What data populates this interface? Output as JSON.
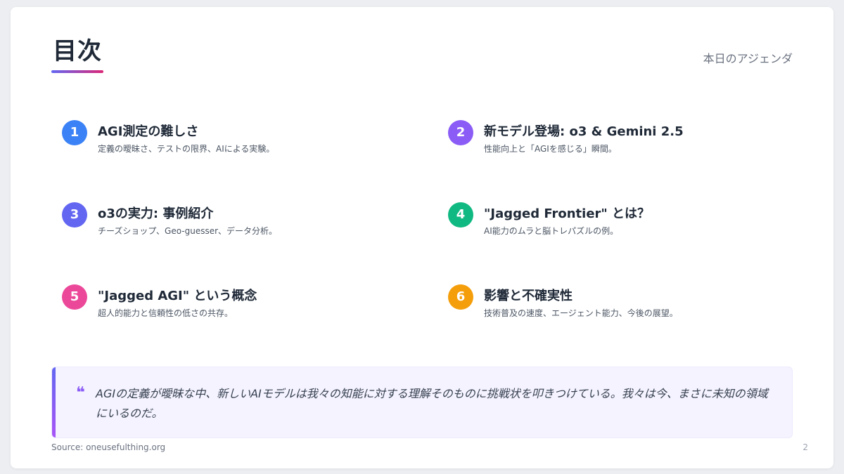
{
  "header": {
    "title": "目次",
    "subtitle": "本日のアジェンダ"
  },
  "items": [
    {
      "number": "1",
      "title": "AGI測定の難しさ",
      "description": "定義の曖昧さ、テストの限界、AIによる実験。",
      "color": "#3b82f6"
    },
    {
      "number": "2",
      "title": "新モデル登場: o3 & Gemini 2.5",
      "description": "性能向上と「AGIを感じる」瞬間。",
      "color": "#8b5cf6"
    },
    {
      "number": "3",
      "title": "o3の実力: 事例紹介",
      "description": "チーズショップ、Geo-guesser、データ分析。",
      "color": "#6366f1"
    },
    {
      "number": "4",
      "title": "\"Jagged Frontier\" とは？",
      "description": "AI能力のムラと脳トレパズルの例。",
      "color": "#10b981"
    },
    {
      "number": "5",
      "title": "\"Jagged AGI\" という概念",
      "description": "超人的能力と信頼性の低さの共存。",
      "color": "#ec4899"
    },
    {
      "number": "6",
      "title": "影響と不確実性",
      "description": "技術普及の速度、エージェント能力、今後の展望。",
      "color": "#f59e0b"
    }
  ],
  "quote": {
    "mark": "❝",
    "text": "AGIの定義が曖昧な中、新しいAIモデルは我々の知能に対する理解そのものに挑戦状を叩きつけている。我々は今、まさに未知の領域にいるのだ。"
  },
  "footer": {
    "source": "Source: oneusefulthing.org",
    "page_number": "2"
  }
}
